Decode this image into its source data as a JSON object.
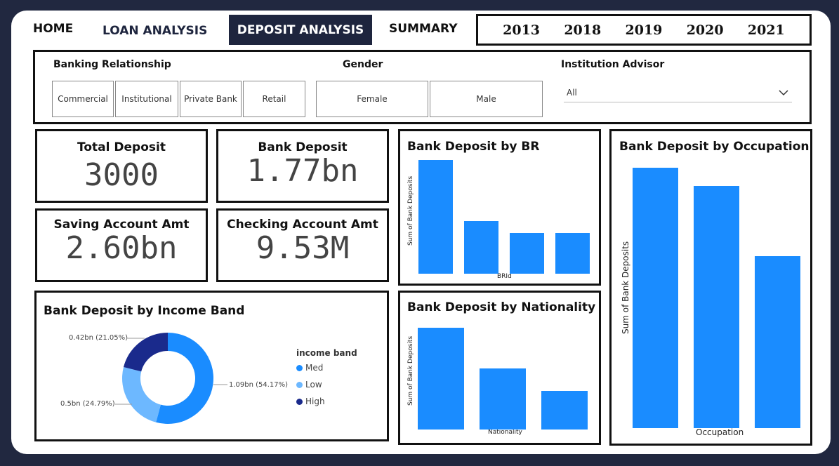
{
  "nav": {
    "home": "HOME",
    "loan": "LOAN ANALYSIS",
    "deposit": "DEPOSIT ANALYSIS",
    "summary": "SUMMARY"
  },
  "years": [
    "2013",
    "2018",
    "2019",
    "2020",
    "2021"
  ],
  "filters": {
    "banking_relationship": {
      "title": "Banking Relationship",
      "options": [
        "Commercial",
        "Institutional",
        "Private Bank",
        "Retail"
      ]
    },
    "gender": {
      "title": "Gender",
      "options": [
        "Female",
        "Male"
      ]
    },
    "advisor": {
      "title": "Institution Advisor",
      "value": "All"
    }
  },
  "kpis": {
    "total_deposit": {
      "title": "Total Deposit",
      "value": "3000"
    },
    "bank_deposit": {
      "title": "Bank Deposit",
      "value": "1.77bn"
    },
    "saving_account": {
      "title": "Saving Account Amt",
      "value": "2.60bn"
    },
    "checking_account": {
      "title": "Checking Account Amt",
      "value": "9.53M"
    }
  },
  "colors": {
    "bar": "#1a8cff",
    "med": "#1a8cff",
    "low": "#6db8ff",
    "high": "#1a2a8c",
    "nav_active": "#1e253e"
  },
  "chart_data": [
    {
      "type": "bar",
      "title": "Bank Deposit by BR",
      "xlabel": "BRId",
      "ylabel": "Sum of Bank Deposits",
      "values": [
        1.0,
        0.46,
        0.36,
        0.355
      ]
    },
    {
      "type": "bar",
      "title": "Bank Deposit by Nationality",
      "xlabel": "Nationality",
      "ylabel": "Sum of Bank Deposits",
      "values": [
        1.0,
        0.6,
        0.38
      ]
    },
    {
      "type": "bar",
      "title": "Bank Deposit by Occupation",
      "xlabel": "Occupation",
      "ylabel": "Sum of Bank Deposits",
      "values": [
        1.0,
        0.93,
        0.66
      ]
    },
    {
      "type": "pie",
      "title": "Bank Deposit by Income Band",
      "legend_title": "income band",
      "slices": [
        {
          "name": "Med",
          "value": 54.17,
          "label": "1.09bn (54.17%)"
        },
        {
          "name": "Low",
          "value": 24.79,
          "label": "0.5bn (24.79%)"
        },
        {
          "name": "High",
          "value": 21.05,
          "label": "0.42bn (21.05%)"
        }
      ]
    }
  ]
}
